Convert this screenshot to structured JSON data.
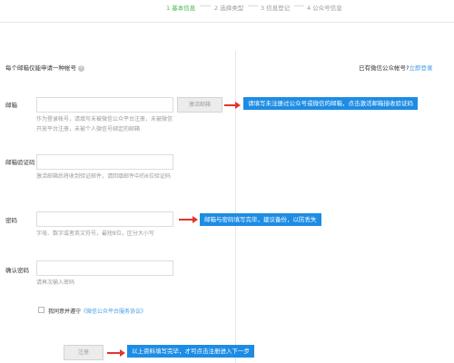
{
  "steps": [
    {
      "label": "1 基本信息"
    },
    {
      "label": "2 选择类型"
    },
    {
      "label": "3 信息登记"
    },
    {
      "label": "4 公众号信息"
    }
  ],
  "header": {
    "notice": "每个邮箱仅能申请一种帐号",
    "help_glyph": "?",
    "login_prompt": "已有微信公众帐号?",
    "login_link": "立即登录"
  },
  "form": {
    "email": {
      "label": "邮箱",
      "value": "",
      "activate_button": "激活邮箱",
      "hint": "作为登录帐号，请填写未被微信公众平台注册，未被微信开放平台注册，未被个人微信号绑定的邮箱"
    },
    "code": {
      "label": "邮箱验证码",
      "value": "",
      "hint": "激活邮箱后将收到验证邮件，请回填邮件中的6位验证码"
    },
    "password": {
      "label": "密码",
      "value": "",
      "hint": "字母、数字或者英文符号，最短8位，区分大小写"
    },
    "confirm": {
      "label": "确认密码",
      "value": "",
      "hint": "请再次输入密码"
    },
    "agreement": {
      "prefix": "我同意并遵守",
      "link": "《微信公众平台服务协议》",
      "checked": false
    },
    "register_button": "注册"
  },
  "callouts": {
    "email": "请填写未注册过公众号或微信的邮箱，点击激活邮箱接收验证码",
    "password": "邮箱与密码填写完毕，建议备份，以防丢失",
    "register": "以上资料填写完毕，才可点击注册进入下一步"
  },
  "colors": {
    "accent_green": "#44b549",
    "callout_blue": "#1d8ce4",
    "arrow_red": "#e4342a",
    "link_blue": "#459ae9"
  }
}
